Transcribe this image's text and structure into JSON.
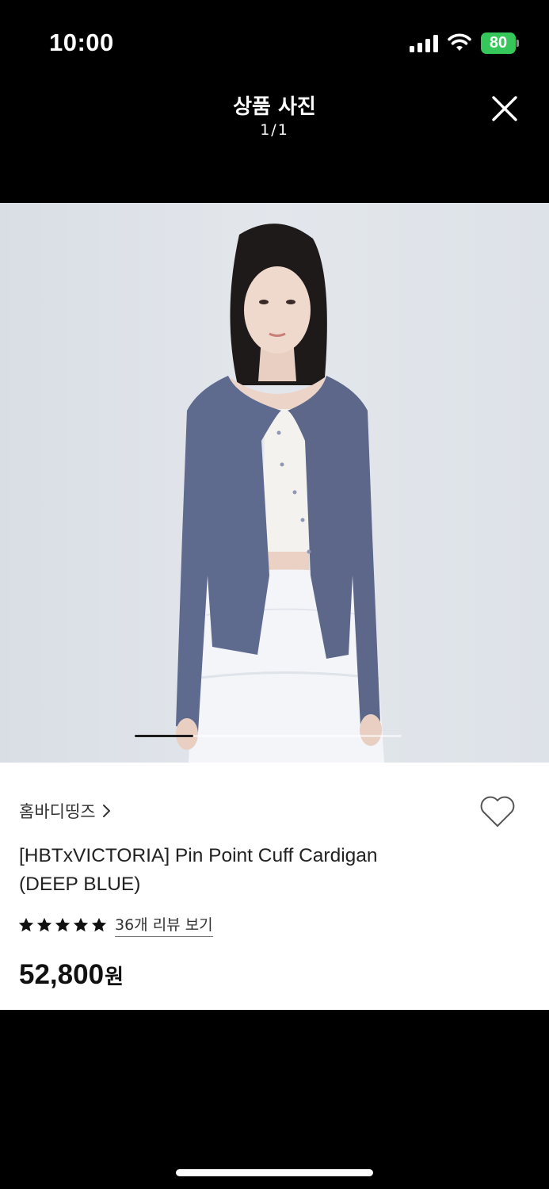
{
  "status_bar": {
    "time": "10:00",
    "battery": "80",
    "icons": [
      "signal-icon",
      "wifi-icon",
      "battery-icon"
    ]
  },
  "header": {
    "title": "상품 사진",
    "counter": "1/1",
    "close_icon": "close-icon"
  },
  "gallery": {
    "image_subject": "model wearing deep blue cardigan",
    "scroll_position": 0.0
  },
  "product": {
    "brand": "홈바디띵즈",
    "title_line1": "[HBTxVICTORIA] Pin Point Cuff Cardigan",
    "title_line2": "(DEEP BLUE)",
    "rating": 5,
    "review_link": "36개 리뷰 보기",
    "price": "52,800",
    "currency": "원"
  },
  "colors": {
    "background": "#000000",
    "panel": "#ffffff",
    "battery": "#35c759",
    "cardigan": "#5f6a8f"
  }
}
